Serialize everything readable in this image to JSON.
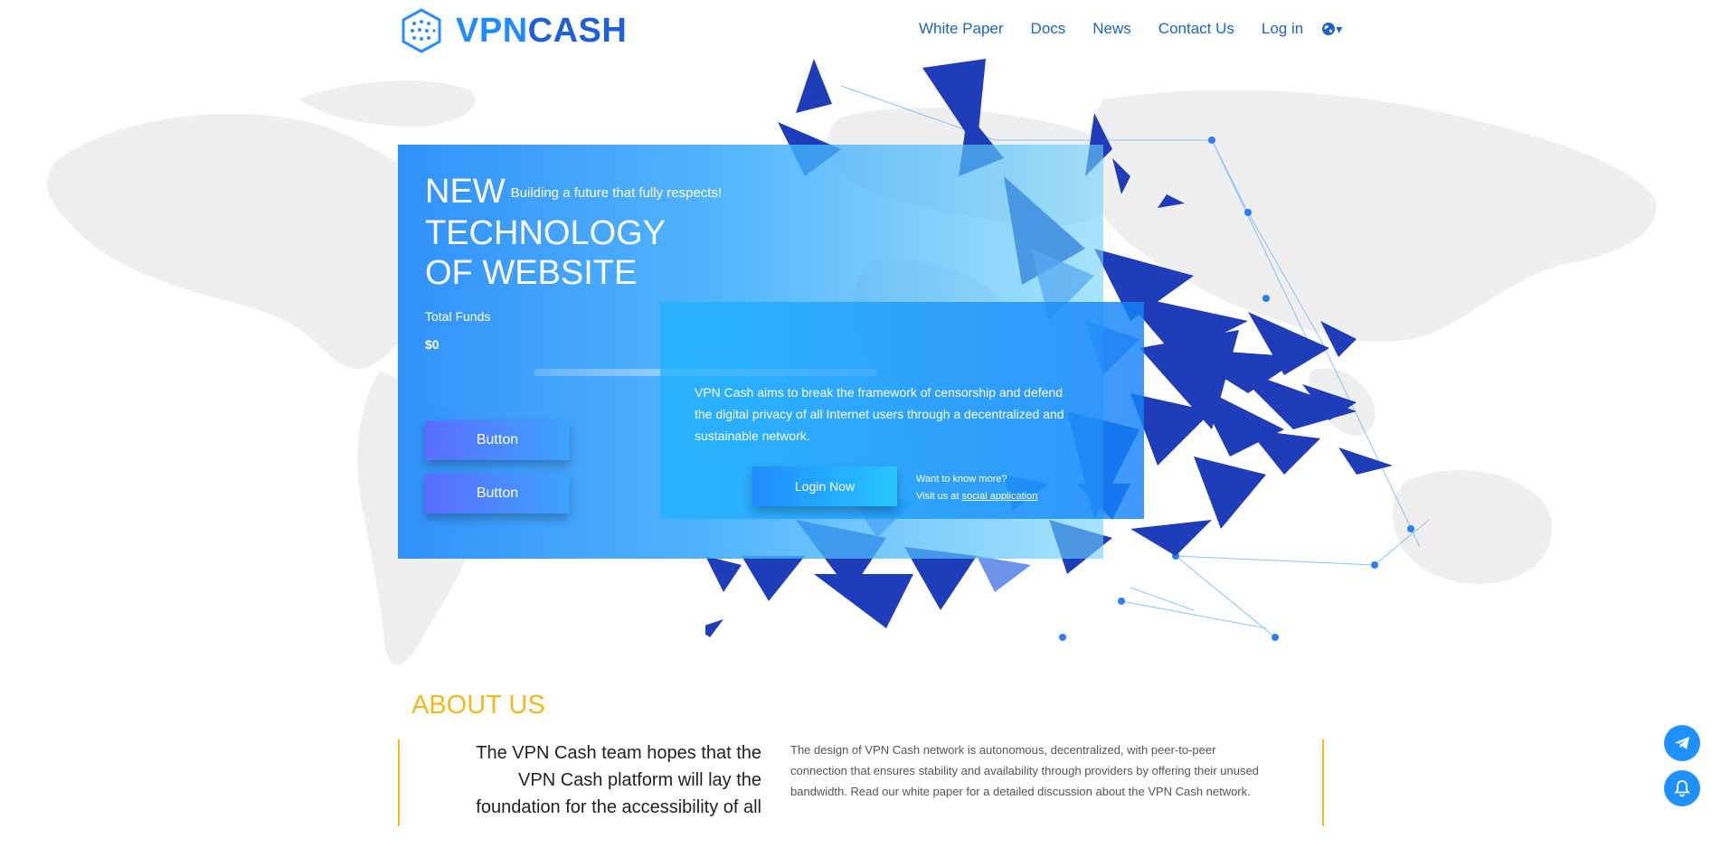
{
  "logo": {
    "part1": "VPN",
    "part2": "CASH"
  },
  "nav": {
    "items": [
      "White Paper",
      "Docs",
      "News",
      "Contact Us"
    ],
    "login": "Log in",
    "language_caret": "▾"
  },
  "hero": {
    "title_line1": "NEW",
    "tagline": "Building a future that fully respects!",
    "title_line2": "TECHNOLOGY",
    "title_line3": "OF WEBSITE",
    "funds_label": "Total Funds",
    "funds_value": "$0",
    "button1": "Button",
    "button2": "Button",
    "description": "VPN Cash aims to break the framework of censorship and defend the digital privacy of all Internet users through a decentralized and sustainable network.",
    "login_button": "Login Now",
    "more_line1": "Want to know more?",
    "more_line2_prefix": "Visit us at ",
    "more_link": "social application"
  },
  "about": {
    "title": "ABOUT US",
    "left_text": "The VPN Cash team hopes that the VPN Cash platform will lay the foundation for the accessibility of all",
    "right_text": "The design of VPN Cash network is autonomous, decentralized, with peer-to-peer connection that ensures stability and availability through providers by offering their unused bandwidth. Read our white paper for a detailed discussion about the VPN Cash network."
  },
  "floating": {
    "telegram_icon": "telegram-icon",
    "bell_icon": "bell-icon"
  },
  "colors": {
    "primary": "#1f8bff",
    "accent": "#f3b81b",
    "nav": "#1f63c7"
  }
}
